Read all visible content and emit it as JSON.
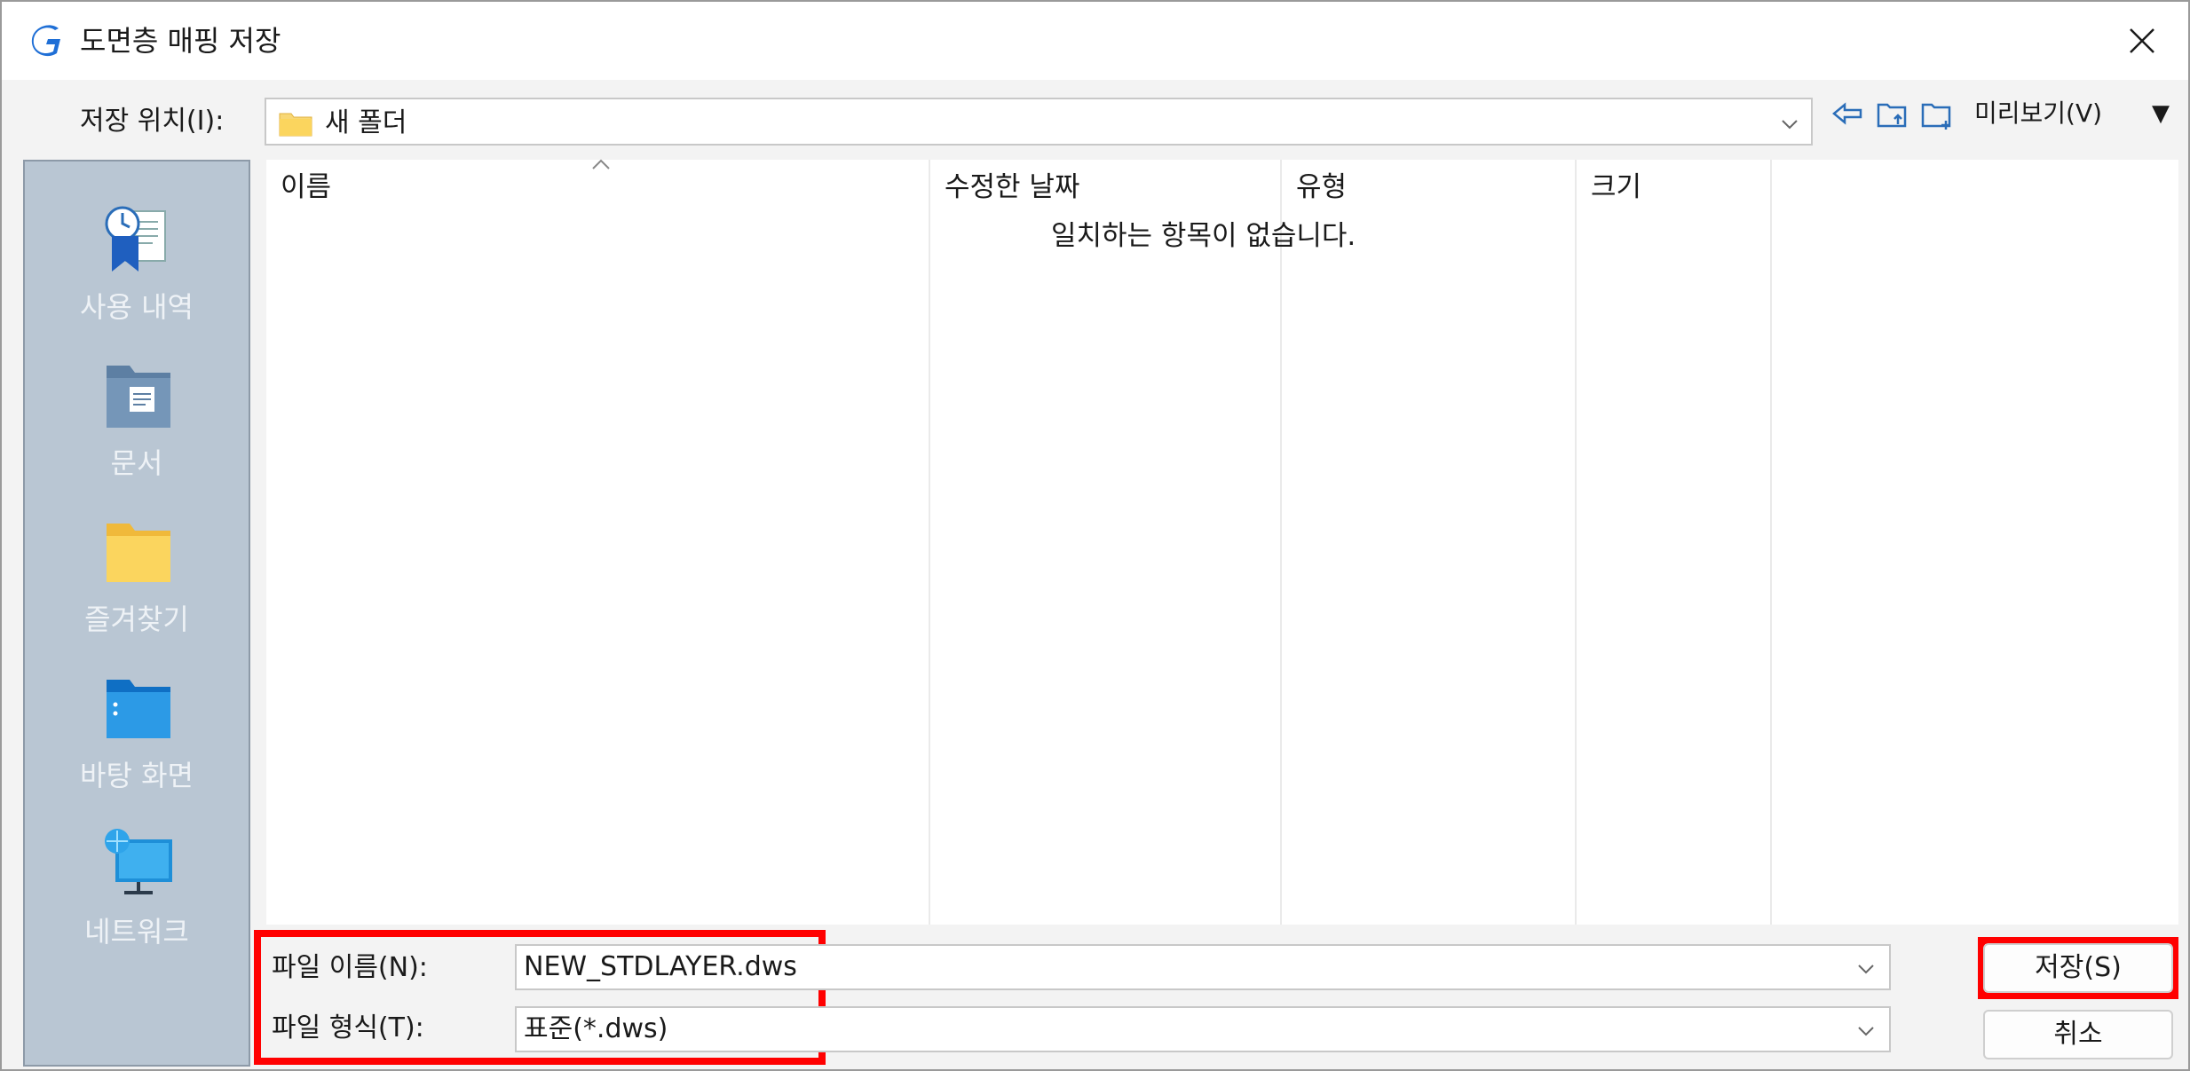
{
  "window": {
    "title": "도면층 매핑 저장"
  },
  "location": {
    "label": "저장 위치(I):",
    "value": "새 폴더"
  },
  "toolbar": {
    "preview_label": "미리보기(V)",
    "preview_arrow": "▼",
    "icons": [
      "back-arrow-icon",
      "up-folder-icon",
      "new-folder-icon"
    ]
  },
  "places": [
    {
      "label": "사용 내역",
      "icon": "recent-history-icon"
    },
    {
      "label": "문서",
      "icon": "documents-icon"
    },
    {
      "label": "즐겨찾기",
      "icon": "favorites-folder-icon"
    },
    {
      "label": "바탕 화면",
      "icon": "desktop-icon"
    },
    {
      "label": "네트워크",
      "icon": "network-icon"
    }
  ],
  "filelist": {
    "columns": [
      "이름",
      "수정한 날짜",
      "유형",
      "크기"
    ],
    "empty_message": "일치하는 항목이 없습니다."
  },
  "filename": {
    "label": "파일 이름(N):",
    "value": "NEW_STDLAYER.dws"
  },
  "filetype": {
    "label": "파일 형식(T):",
    "value": "표준(*.dws)"
  },
  "buttons": {
    "save": "저장(S)",
    "cancel": "취소"
  },
  "colors": {
    "highlight": "#ff0000",
    "places_bg": "#b9c6d3",
    "accent": "#1f6fd6"
  }
}
